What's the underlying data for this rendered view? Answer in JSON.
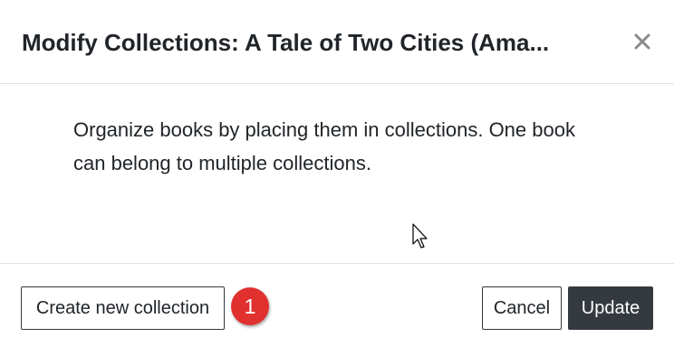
{
  "dialog": {
    "title": "Modify Collections: A Tale of Two Cities (Ama...",
    "close_icon": "close-icon",
    "description": "Organize books by placing them in collections. One book can belong to multiple collections.",
    "buttons": {
      "create_label": "Create new collection",
      "cancel_label": "Cancel",
      "update_label": "Update"
    },
    "step_badge": "1"
  },
  "colors": {
    "primary_dark": "#343a40",
    "badge_red": "#e0312f",
    "divider": "#dee2e6",
    "text": "#212529"
  }
}
